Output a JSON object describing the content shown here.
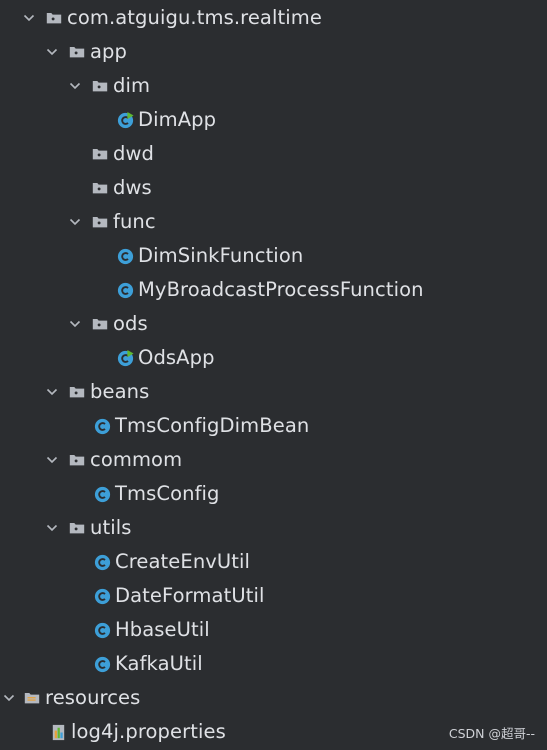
{
  "tree": {
    "root_package": "com.atguigu.tms.realtime",
    "app": "app",
    "dim": "dim",
    "dim_app": "DimApp",
    "dwd": "dwd",
    "dws": "dws",
    "func": "func",
    "dim_sink_function": "DimSinkFunction",
    "my_broadcast_process_function": "MyBroadcastProcessFunction",
    "ods": "ods",
    "ods_app": "OdsApp",
    "beans": "beans",
    "tms_config_dim_bean": "TmsConfigDimBean",
    "commom": "commom",
    "tms_config": "TmsConfig",
    "utils": "utils",
    "create_env_util": "CreateEnvUtil",
    "date_format_util": "DateFormatUtil",
    "hbase_util": "HbaseUtil",
    "kafka_util": "KafkaUtil",
    "resources": "resources",
    "log4j_properties": "log4j.properties"
  },
  "watermark": "CSDN @超哥--",
  "colors": {
    "background": "#2b2d30",
    "text": "#dfe1e5",
    "folder_icon": "#b4b8bf",
    "class_icon": "#3d9fd8",
    "run_badge": "#5fb832"
  }
}
